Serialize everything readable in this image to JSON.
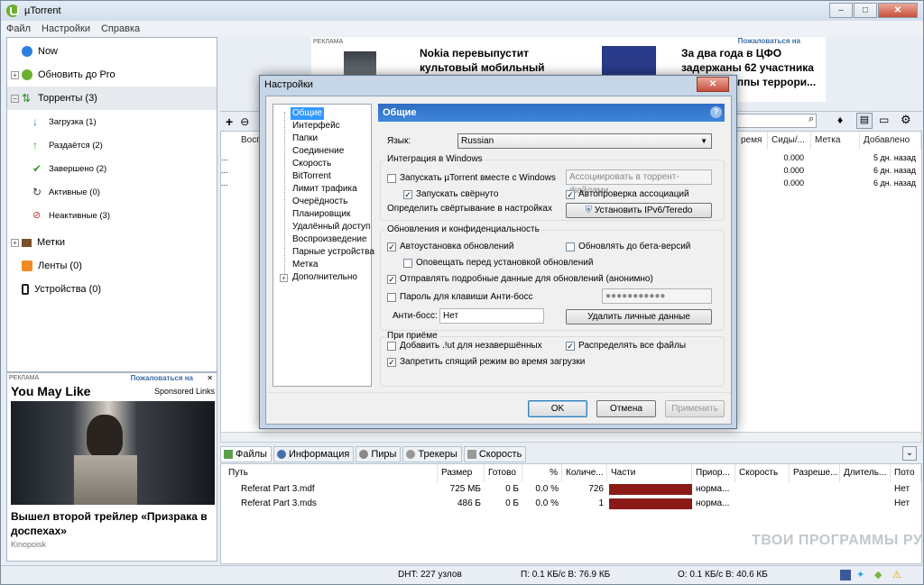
{
  "app": {
    "title": "µTorrent",
    "brand_color": "#6ab02e"
  },
  "window_controls": {
    "minimize": "–",
    "maximize": "□",
    "close": "✕"
  },
  "menu": [
    "Файл",
    "Настройки",
    "Справка"
  ],
  "sidebar": {
    "items": [
      {
        "label": "Now",
        "icon": "globe-icon"
      },
      {
        "label": "Обновить до Pro",
        "icon": "utorrent-icon"
      },
      {
        "label": "Торренты (3)",
        "icon": "torrents-icon"
      },
      {
        "label": "Загрузка (1)",
        "icon": "arrow-down-icon"
      },
      {
        "label": "Раздаётся (2)",
        "icon": "arrow-up-icon"
      },
      {
        "label": "Завершено (2)",
        "icon": "check-icon"
      },
      {
        "label": "Активные (0)",
        "icon": "refresh-icon"
      },
      {
        "label": "Неактивные (3)",
        "icon": "inactive-icon"
      },
      {
        "label": "Метки",
        "icon": "label-icon"
      },
      {
        "label": "Ленты (0)",
        "icon": "rss-icon"
      },
      {
        "label": "Устройства (0)",
        "icon": "device-icon"
      }
    ]
  },
  "side_ad": {
    "label": "РЕКЛАМА",
    "link": "Пожаловаться на",
    "heading": "You May Like",
    "sponsored": "Sponsored Links",
    "caption": "Вышел второй трейлер «Призрака в доспехах»",
    "source": "Kinopoisk"
  },
  "top_ad": {
    "label": "РЕКЛАМА",
    "link": "Пожаловаться на",
    "left_text": "Nokia перевыпустит культовый мобильный телефон 3310",
    "right_text": "За два года в ЦФО задержаны 62 участника банд и группы террори..."
  },
  "torrent_list": {
    "headers": [
      "Восп",
      "ремя",
      "Сиды/...",
      "Метка",
      "Добавлено"
    ],
    "rows": [
      {
        "name": "...",
        "ratio": "0.000",
        "added": "5 дн. назад"
      },
      {
        "name": "...",
        "ratio": "0.000",
        "added": "6 дн. назад"
      },
      {
        "name": "...",
        "ratio": "0.000",
        "added": "6 дн. назад"
      }
    ]
  },
  "bottom_tabs": [
    "Файлы",
    "Информация",
    "Пиры",
    "Трекеры",
    "Скорость"
  ],
  "files": {
    "headers": [
      "Путь",
      "Размер",
      "Готово",
      "%",
      "Количе...",
      "Части",
      "Приор...",
      "Скорость",
      "Разреше...",
      "Длитель...",
      "Пото"
    ],
    "rows": [
      {
        "path": "Referat Part 3.mdf",
        "size": "725 МБ",
        "done": "0 Б",
        "pct": "0.0 %",
        "count": "726",
        "priority": "норма...",
        "stream": "Нет"
      },
      {
        "path": "Referat Part 3.mds",
        "size": "486 Б",
        "done": "0 Б",
        "pct": "0.0 %",
        "count": "1",
        "priority": "норма...",
        "stream": "Нет"
      }
    ]
  },
  "status": {
    "dht": "DHT: 227 узлов",
    "download": "П: 0.1 КБ/с В: 76.9 КБ",
    "upload": "О: 0.1 КБ/с В: 40.6 КБ"
  },
  "watermark": "ТВОИ ПРОГРАММЫ РУ",
  "dialog": {
    "title": "Настройки",
    "close": "✕",
    "tree": [
      "Общие",
      "Интерфейс",
      "Папки",
      "Соединение",
      "Скорость",
      "BitTorrent",
      "Лимит трафика",
      "Очерёдность",
      "Планировщик",
      "Удалённый доступ",
      "Воспроизведение",
      "Парные устройства",
      "Метка",
      "Дополнительно"
    ],
    "panel_title": "Общие",
    "help": "?",
    "language_label": "Язык:",
    "language_value": "Russian",
    "windows_group": "Интеграция в Windows",
    "start_with_windows": "Запускать µTorrent вместе с Windows",
    "associate_btn": "Ассоциировать в торрент-файлами",
    "start_minimized": "Запускать свёрнуто",
    "auto_check_assoc": "Автопроверка ассоциаций",
    "minimize_behavior": "Определить свёртывание в настройках",
    "ipv6_btn": "Установить IPv6/Teredo",
    "updates_group": "Обновления и конфиденциальность",
    "auto_update": "Автоустановка обновлений",
    "beta_update": "Обновлять до бета-версий",
    "notify_before": "Оповещать перед установкой обновлений",
    "send_data": "Отправлять подробные данные для обновлений (анонимно)",
    "boss_password": "Пароль для клавиши Анти-босс",
    "password_value": "●●●●●●●●●●●",
    "boss_label": "Анти-босс:",
    "boss_value": "Нет",
    "delete_data_btn": "Удалить личные данные",
    "receive_group": "При приёме",
    "add_ut": "Добавить .!ut для незавершённых",
    "distribute_all": "Распределять все файлы",
    "prevent_sleep": "Запретить спящий режим во время загрузки",
    "ok": "OK",
    "cancel": "Отмена",
    "apply": "Применить"
  }
}
